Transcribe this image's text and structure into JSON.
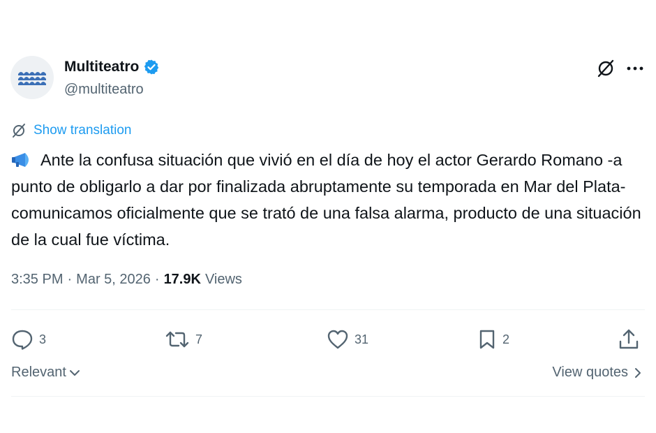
{
  "account": {
    "name": "Multiteatro",
    "handle": "@multiteatro",
    "verified": true,
    "verified_color": "#1d9bf0",
    "avatar_icon": "multiteatro-logo"
  },
  "header_actions": [
    "grok-icon",
    "more-icon"
  ],
  "translation": {
    "label": "Show translation"
  },
  "tweet": {
    "emoji": "megaphone",
    "text": "Ante la confusa situación que vivió en el día de hoy el actor Gerardo Romano -a punto de obligarlo a dar por finalizada abruptamente su temporada en Mar del Plata- comunicamos oficialmente que se trató de una falsa alarma, producto de una situación de la cual fue víctima."
  },
  "meta": {
    "time": "3:35 PM",
    "separator": "·",
    "date": "Mar 5, 2026",
    "views_count": "17.9K",
    "views_label": "Views"
  },
  "actions": {
    "replies": "3",
    "reposts": "7",
    "likes": "31",
    "bookmarks": "2"
  },
  "footer": {
    "sort_label": "Relevant",
    "quotes_label": "View quotes"
  },
  "colors": {
    "text": "#0f1419",
    "secondary": "#536471",
    "link": "#1d9bf0",
    "divider": "#eff3f4"
  }
}
